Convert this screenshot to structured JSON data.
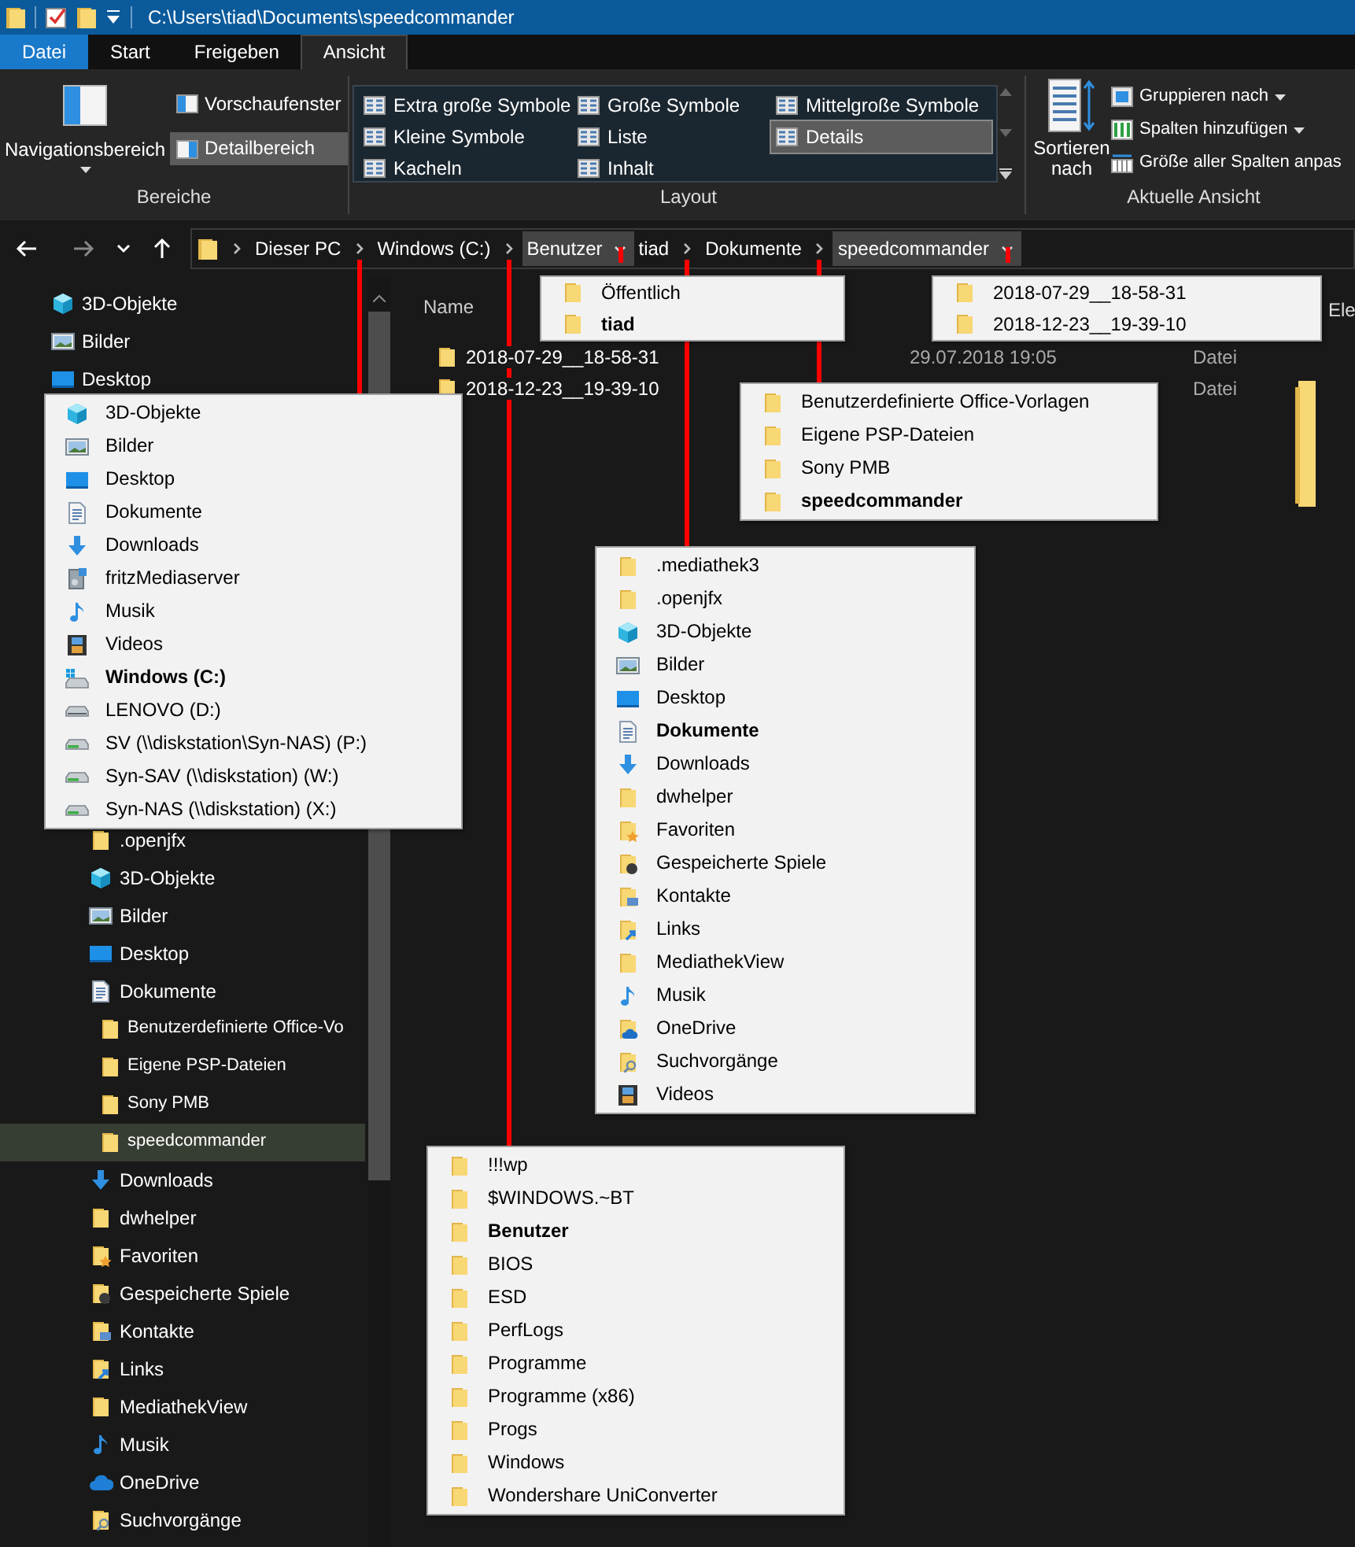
{
  "title_bar": {
    "path": "C:\\Users\\tiad\\Documents\\speedcommander"
  },
  "ribbon": {
    "tabs": [
      {
        "label": "Datei",
        "kind": "backstage",
        "selected": false
      },
      {
        "label": "Start",
        "kind": "tab",
        "selected": false
      },
      {
        "label": "Freigeben",
        "kind": "tab",
        "selected": false
      },
      {
        "label": "Ansicht",
        "kind": "tab",
        "selected": true
      }
    ],
    "groups": [
      {
        "label": "Bereiche",
        "kind": "panes",
        "large": {
          "label": "Navigationsbereich"
        },
        "buttons": [
          {
            "label": "Vorschaufenster",
            "selected": false
          },
          {
            "label": "Detailbereich",
            "selected": true
          }
        ]
      },
      {
        "label": "Layout",
        "kind": "gallery",
        "options": [
          {
            "label": "Extra große Symbole",
            "selected": false
          },
          {
            "label": "Große Symbole",
            "selected": false
          },
          {
            "label": "Mittelgroße Symbole",
            "selected": false
          },
          {
            "label": "Kleine Symbole",
            "selected": false
          },
          {
            "label": "Liste",
            "selected": false
          },
          {
            "label": "Details",
            "selected": true
          },
          {
            "label": "Kacheln",
            "selected": false
          },
          {
            "label": "Inhalt",
            "selected": false
          }
        ]
      },
      {
        "label": "Aktuelle Ansicht",
        "kind": "view",
        "large": {
          "label": "Sortieren nach"
        },
        "buttons": [
          {
            "label": "Gruppieren nach",
            "menu": true
          },
          {
            "label": "Spalten hinzufügen",
            "menu": true
          },
          {
            "label": "Größe aller Spalten anpas",
            "menu": false
          }
        ]
      }
    ]
  },
  "address_bar": {
    "crumbs": [
      {
        "label": "Dieser PC",
        "expanded": false
      },
      {
        "label": "Windows (C:)",
        "expanded": false
      },
      {
        "label": "Benutzer",
        "expanded": true
      },
      {
        "label": "tiad",
        "expanded": false
      },
      {
        "label": "Dokumente",
        "expanded": false
      },
      {
        "label": "speedcommander",
        "expanded": true
      }
    ]
  },
  "sidebar": {
    "upper_items": [
      {
        "label": "3D-Objekte",
        "kind": "cube",
        "selected": false
      },
      {
        "label": "Bilder",
        "kind": "pictures",
        "selected": false
      },
      {
        "label": "Desktop",
        "kind": "desktop",
        "selected": false
      }
    ],
    "lower_items": [
      {
        "label": ".openjfx",
        "kind": "folder",
        "selected": false
      },
      {
        "label": "3D-Objekte",
        "kind": "cube",
        "selected": false
      },
      {
        "label": "Bilder",
        "kind": "pictures",
        "selected": false
      },
      {
        "label": "Desktop",
        "kind": "desktop",
        "selected": false
      },
      {
        "label": "Dokumente",
        "kind": "documents",
        "selected": false,
        "children": [
          {
            "label": "Benutzerdefinierte Office-Vo",
            "kind": "folder",
            "selected": false
          },
          {
            "label": "Eigene PSP-Dateien",
            "kind": "folder",
            "selected": false
          },
          {
            "label": "Sony PMB",
            "kind": "folder",
            "selected": false
          },
          {
            "label": "speedcommander",
            "kind": "folder",
            "selected": true
          }
        ]
      },
      {
        "label": "Downloads",
        "kind": "downloads",
        "selected": false
      },
      {
        "label": "dwhelper",
        "kind": "folder",
        "selected": false
      },
      {
        "label": "Favoriten",
        "kind": "favorites",
        "selected": false
      },
      {
        "label": "Gespeicherte Spiele",
        "kind": "games",
        "selected": false
      },
      {
        "label": "Kontakte",
        "kind": "contacts",
        "selected": false
      },
      {
        "label": "Links",
        "kind": "links",
        "selected": false
      },
      {
        "label": "MediathekView",
        "kind": "folder",
        "selected": false
      },
      {
        "label": "Musik",
        "kind": "music",
        "selected": false
      },
      {
        "label": "OneDrive",
        "kind": "onedrive",
        "selected": false
      },
      {
        "label": "Suchvorgänge",
        "kind": "search-folder",
        "selected": false
      }
    ]
  },
  "file_list": {
    "columns": [
      {
        "label": "Name"
      }
    ],
    "rows": [
      {
        "name": "2018-07-29__18-58-31",
        "date": "29.07.2018 19:05",
        "type": "Datei"
      },
      {
        "name": "2018-12-23__19-39-10",
        "type": "Datei"
      }
    ]
  },
  "preview_pane": {
    "text": "Ele"
  },
  "dropdowns": [
    {
      "items": [
        {
          "label": "3D-Objekte",
          "kind": "cube",
          "selected": false
        },
        {
          "label": "Bilder",
          "kind": "pictures",
          "selected": false
        },
        {
          "label": "Desktop",
          "kind": "desktop",
          "selected": false
        },
        {
          "label": "Dokumente",
          "kind": "documents",
          "selected": false
        },
        {
          "label": "Downloads",
          "kind": "downloads",
          "selected": false
        },
        {
          "label": "fritzMediaserver",
          "kind": "media-server",
          "selected": false
        },
        {
          "label": "Musik",
          "kind": "music",
          "selected": false
        },
        {
          "label": "Videos",
          "kind": "videos",
          "selected": false
        },
        {
          "label": "Windows (C:)",
          "kind": "windows-drive",
          "selected": true
        },
        {
          "label": "LENOVO (D:)",
          "kind": "drive",
          "selected": false
        },
        {
          "label": "SV (\\\\diskstation\\Syn-NAS) (P:)",
          "kind": "network-drive",
          "selected": false
        },
        {
          "label": "Syn-SAV (\\\\diskstation) (W:)",
          "kind": "network-drive",
          "selected": false
        },
        {
          "label": "Syn-NAS (\\\\diskstation) (X:)",
          "kind": "network-drive",
          "selected": false
        }
      ]
    },
    {
      "items": [
        {
          "label": "Öffentlich",
          "kind": "folder",
          "selected": false
        },
        {
          "label": "tiad",
          "kind": "folder",
          "selected": true
        }
      ]
    },
    {
      "items": [
        {
          "label": "2018-07-29__18-58-31",
          "kind": "folder",
          "selected": false
        },
        {
          "label": "2018-12-23__19-39-10",
          "kind": "folder",
          "selected": false
        }
      ]
    },
    {
      "items": [
        {
          "label": "Benutzerdefinierte Office-Vorlagen",
          "kind": "folder",
          "selected": false
        },
        {
          "label": "Eigene PSP-Dateien",
          "kind": "folder",
          "selected": false
        },
        {
          "label": "Sony PMB",
          "kind": "folder",
          "selected": false
        },
        {
          "label": "speedcommander",
          "kind": "folder",
          "selected": true
        }
      ]
    },
    {
      "items": [
        {
          "label": ".mediathek3",
          "kind": "folder",
          "selected": false
        },
        {
          "label": ".openjfx",
          "kind": "folder",
          "selected": false
        },
        {
          "label": "3D-Objekte",
          "kind": "cube",
          "selected": false
        },
        {
          "label": "Bilder",
          "kind": "pictures",
          "selected": false
        },
        {
          "label": "Desktop",
          "kind": "desktop",
          "selected": false
        },
        {
          "label": "Dokumente",
          "kind": "documents",
          "selected": true
        },
        {
          "label": "Downloads",
          "kind": "downloads",
          "selected": false
        },
        {
          "label": "dwhelper",
          "kind": "folder",
          "selected": false
        },
        {
          "label": "Favoriten",
          "kind": "favorites",
          "selected": false
        },
        {
          "label": "Gespeicherte Spiele",
          "kind": "games",
          "selected": false
        },
        {
          "label": "Kontakte",
          "kind": "contacts",
          "selected": false
        },
        {
          "label": "Links",
          "kind": "links",
          "selected": false
        },
        {
          "label": "MediathekView",
          "kind": "folder",
          "selected": false
        },
        {
          "label": "Musik",
          "kind": "music",
          "selected": false
        },
        {
          "label": "OneDrive",
          "kind": "onedrive-folder",
          "selected": false
        },
        {
          "label": "Suchvorgänge",
          "kind": "search-folder",
          "selected": false
        },
        {
          "label": "Videos",
          "kind": "videos",
          "selected": false
        }
      ]
    },
    {
      "items": [
        {
          "label": "!!!wp",
          "kind": "folder",
          "selected": false
        },
        {
          "label": "$WINDOWS.~BT",
          "kind": "folder",
          "selected": false
        },
        {
          "label": "Benutzer",
          "kind": "folder",
          "selected": true
        },
        {
          "label": "BIOS",
          "kind": "folder",
          "selected": false
        },
        {
          "label": "ESD",
          "kind": "folder",
          "selected": false
        },
        {
          "label": "PerfLogs",
          "kind": "folder",
          "selected": false
        },
        {
          "label": "Programme",
          "kind": "folder",
          "selected": false
        },
        {
          "label": "Programme (x86)",
          "kind": "folder",
          "selected": false
        },
        {
          "label": "Progs",
          "kind": "folder",
          "selected": false
        },
        {
          "label": "Windows",
          "kind": "folder",
          "selected": false
        },
        {
          "label": "Wondershare UniConverter",
          "kind": "folder",
          "selected": false
        }
      ]
    }
  ]
}
